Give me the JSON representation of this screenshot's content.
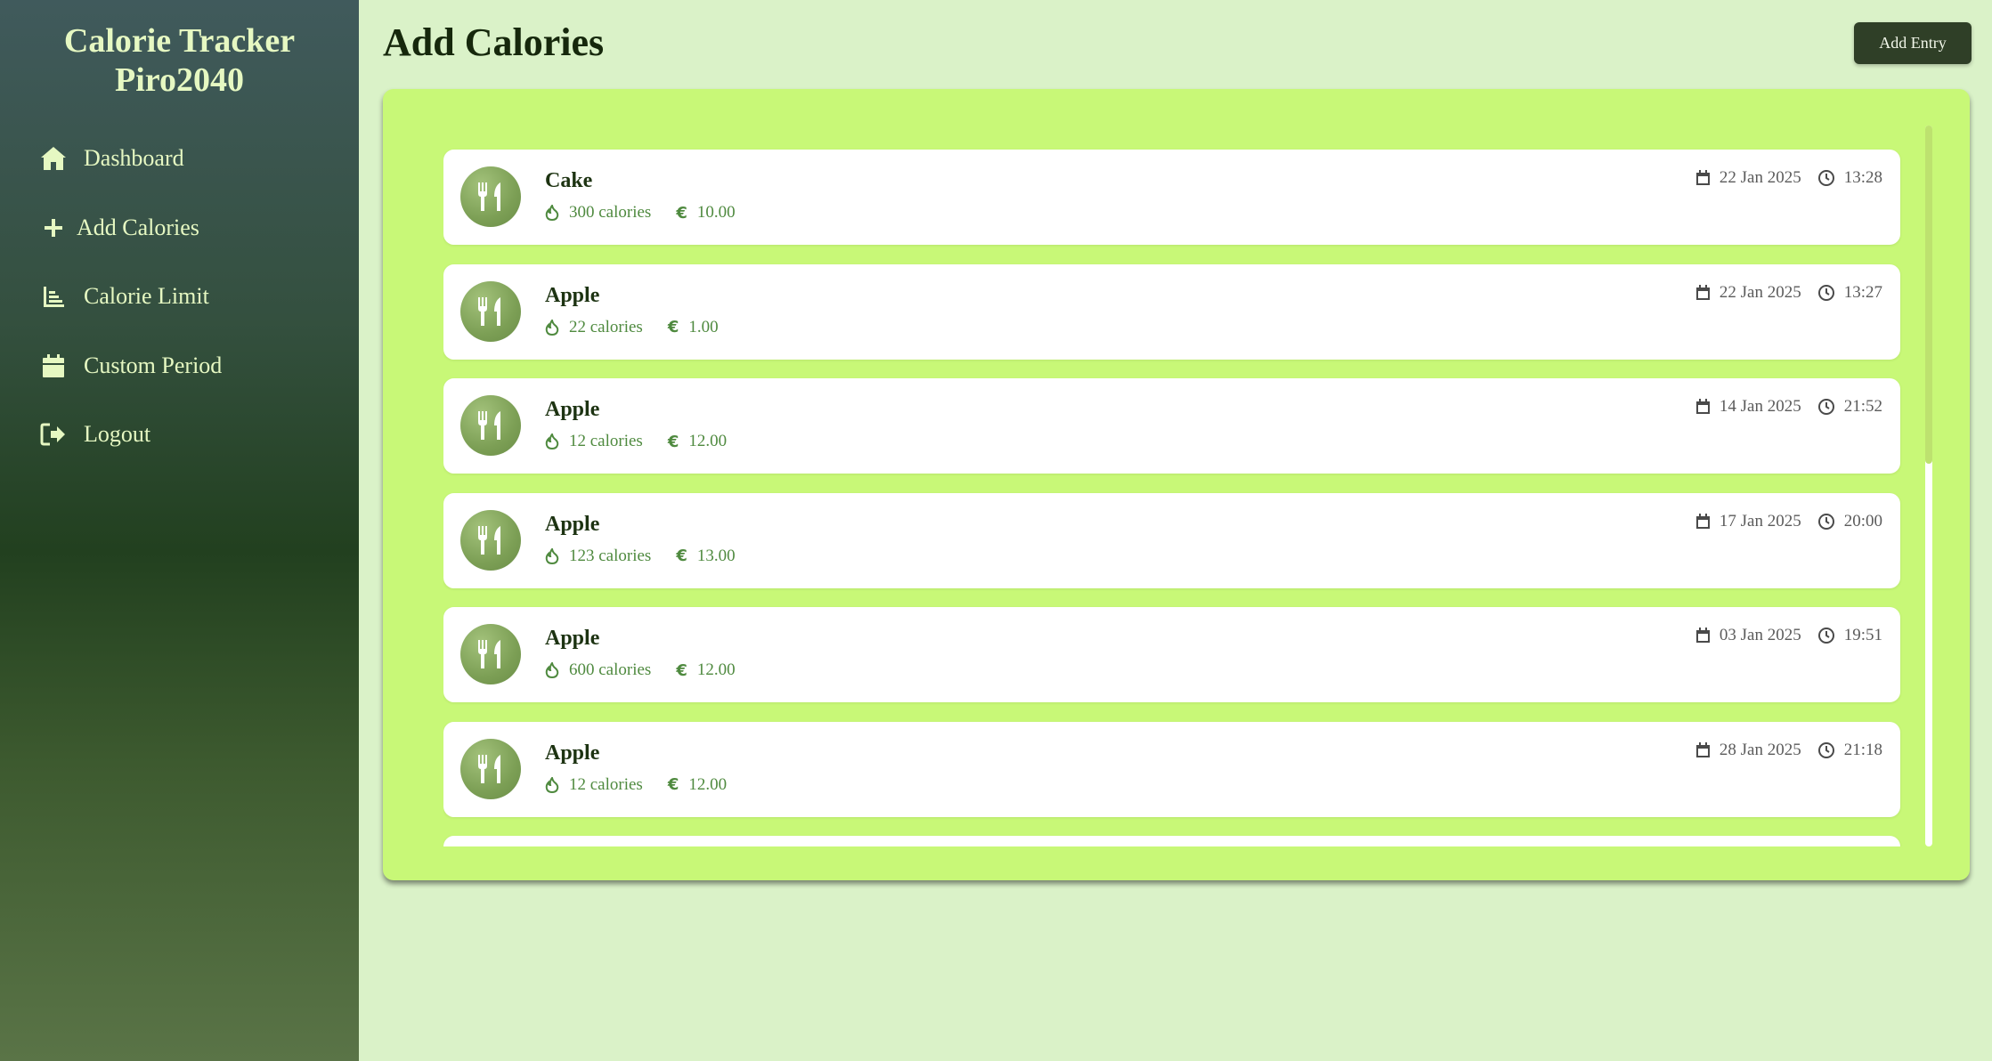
{
  "sidebar": {
    "brand_line1": "Calorie Tracker",
    "brand_line2": "Piro2040",
    "items": [
      {
        "label": "Dashboard",
        "icon": "home-icon"
      },
      {
        "label": "Add Calories",
        "icon": "plus-icon"
      },
      {
        "label": "Calorie Limit",
        "icon": "bar-chart-icon"
      },
      {
        "label": "Custom Period",
        "icon": "calendar-icon"
      },
      {
        "label": "Logout",
        "icon": "logout-icon"
      }
    ]
  },
  "header": {
    "title": "Add Calories",
    "add_entry_label": "Add Entry"
  },
  "entries": [
    {
      "name": "Cake",
      "calories": "300 calories",
      "price": "10.00",
      "date": "22 Jan 2025",
      "time": "13:28"
    },
    {
      "name": "Apple",
      "calories": "22 calories",
      "price": "1.00",
      "date": "22 Jan 2025",
      "time": "13:27"
    },
    {
      "name": "Apple",
      "calories": "12 calories",
      "price": "12.00",
      "date": "14 Jan 2025",
      "time": "21:52"
    },
    {
      "name": "Apple",
      "calories": "123 calories",
      "price": "13.00",
      "date": "17 Jan 2025",
      "time": "20:00"
    },
    {
      "name": "Apple",
      "calories": "600 calories",
      "price": "12.00",
      "date": "03 Jan 2025",
      "time": "19:51"
    },
    {
      "name": "Apple",
      "calories": "12 calories",
      "price": "12.00",
      "date": "28 Jan 2025",
      "time": "21:18"
    }
  ],
  "icons": {
    "avatar": "utensils-icon",
    "calories": "fire-icon",
    "price": "euro-icon",
    "date": "calendar-icon",
    "time": "clock-icon"
  },
  "colors": {
    "accent": "#c8f877",
    "page_bg": "#daf2c8",
    "button_bg": "#2f3f27",
    "meta_text": "#4f8a3f"
  }
}
